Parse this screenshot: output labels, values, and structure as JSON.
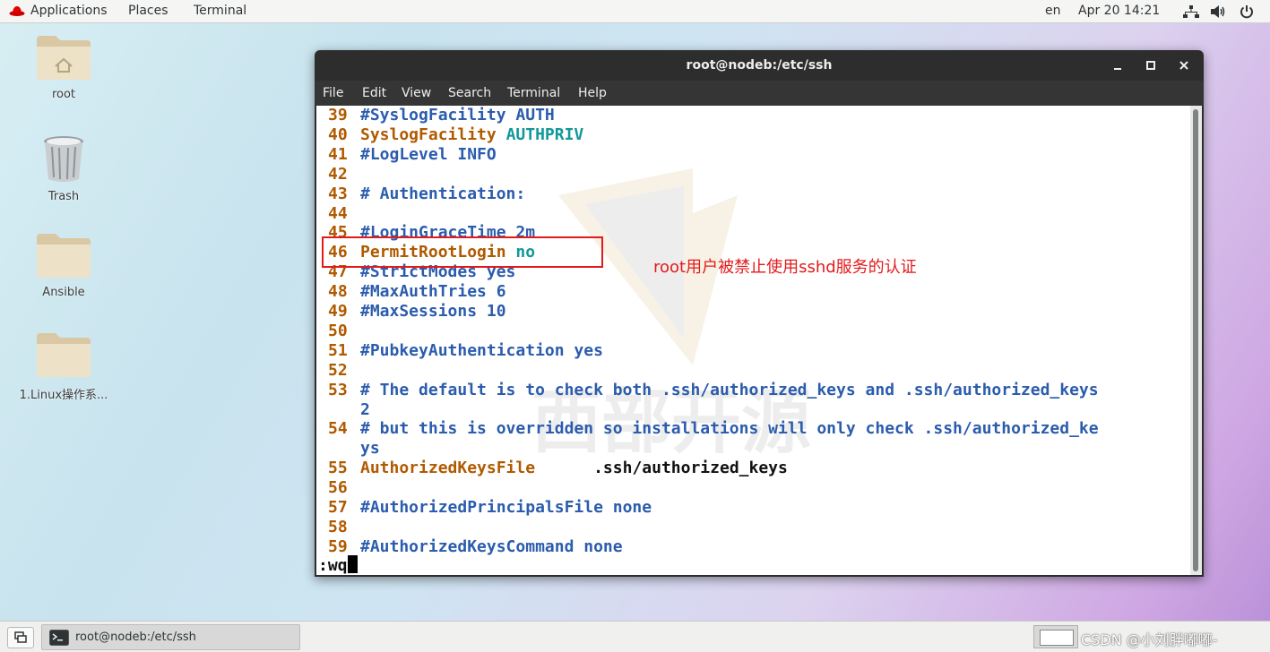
{
  "topbar": {
    "applications": "Applications",
    "places": "Places",
    "terminal": "Terminal",
    "language": "en",
    "datetime": "Apr 20  14:21",
    "icons": [
      "redhat-icon",
      "network-icon",
      "volume-icon",
      "power-icon"
    ]
  },
  "desktop": {
    "icons": [
      {
        "label": "root",
        "icon": "home-folder-icon"
      },
      {
        "label": "Trash",
        "icon": "trash-icon"
      },
      {
        "label": "Ansible",
        "icon": "folder-icon"
      },
      {
        "label": "1.Linux操作系...",
        "icon": "folder-icon"
      }
    ]
  },
  "window": {
    "title": "root@nodeb:/etc/ssh",
    "buttons": [
      "minimize",
      "maximize",
      "close"
    ],
    "menu": [
      "File",
      "Edit",
      "View",
      "Search",
      "Terminal",
      "Help"
    ]
  },
  "editor": {
    "lines": [
      {
        "num": "39",
        "parts": [
          {
            "t": "#SyslogFacility AUTH",
            "c": "cm"
          }
        ]
      },
      {
        "num": "40",
        "parts": [
          {
            "t": "SyslogFacility ",
            "c": "kw"
          },
          {
            "t": "AUTHPRIV",
            "c": "val"
          }
        ]
      },
      {
        "num": "41",
        "parts": [
          {
            "t": "#LogLevel INFO",
            "c": "cm"
          }
        ]
      },
      {
        "num": "42",
        "parts": []
      },
      {
        "num": "43",
        "parts": [
          {
            "t": "# Authentication:",
            "c": "cm"
          }
        ]
      },
      {
        "num": "44",
        "parts": []
      },
      {
        "num": "45",
        "parts": [
          {
            "t": "#LoginGraceTime 2m",
            "c": "cm"
          }
        ]
      },
      {
        "num": "46",
        "parts": [
          {
            "t": "PermitRootLogin ",
            "c": "kw"
          },
          {
            "t": "no",
            "c": "val"
          }
        ]
      },
      {
        "num": "47",
        "parts": [
          {
            "t": "#StrictModes yes",
            "c": "cm"
          }
        ]
      },
      {
        "num": "48",
        "parts": [
          {
            "t": "#MaxAuthTries 6",
            "c": "cm"
          }
        ]
      },
      {
        "num": "49",
        "parts": [
          {
            "t": "#MaxSessions 10",
            "c": "cm"
          }
        ]
      },
      {
        "num": "50",
        "parts": []
      },
      {
        "num": "51",
        "parts": [
          {
            "t": "#PubkeyAuthentication yes",
            "c": "cm"
          }
        ]
      },
      {
        "num": "52",
        "parts": []
      },
      {
        "num": "53",
        "parts": [
          {
            "t": "# The default is to check both .ssh/authorized_keys and .ssh/authorized_keys",
            "c": "cm"
          }
        ]
      },
      {
        "num": "",
        "parts": [
          {
            "t": "2",
            "c": "cm"
          }
        ]
      },
      {
        "num": "54",
        "parts": [
          {
            "t": "# but this is overridden so installations will only check .ssh/authorized_ke",
            "c": "cm"
          }
        ]
      },
      {
        "num": "",
        "parts": [
          {
            "t": "ys",
            "c": "cm"
          }
        ]
      },
      {
        "num": "55",
        "parts": [
          {
            "t": "AuthorizedKeysFile",
            "c": "kw"
          },
          {
            "t": "      .ssh/authorized_keys",
            "c": "plain"
          }
        ]
      },
      {
        "num": "56",
        "parts": []
      },
      {
        "num": "57",
        "parts": [
          {
            "t": "#AuthorizedPrincipalsFile none",
            "c": "cm"
          }
        ]
      },
      {
        "num": "58",
        "parts": []
      },
      {
        "num": "59",
        "parts": [
          {
            "t": "#AuthorizedKeysCommand none",
            "c": "cm"
          }
        ]
      }
    ],
    "command": ":wq"
  },
  "annotation": {
    "text": "root用户被禁止使用sshd服务的认证",
    "color": "#e31a1a"
  },
  "watermark_text": "西部开源",
  "taskbar": {
    "task_label": "root@nodeb:/etc/ssh",
    "credit": "CSDN @小刘胖嘟嘟-"
  },
  "colors": {
    "keyword": "#b05a00",
    "comment": "#2b5cad",
    "value": "#12989a"
  }
}
